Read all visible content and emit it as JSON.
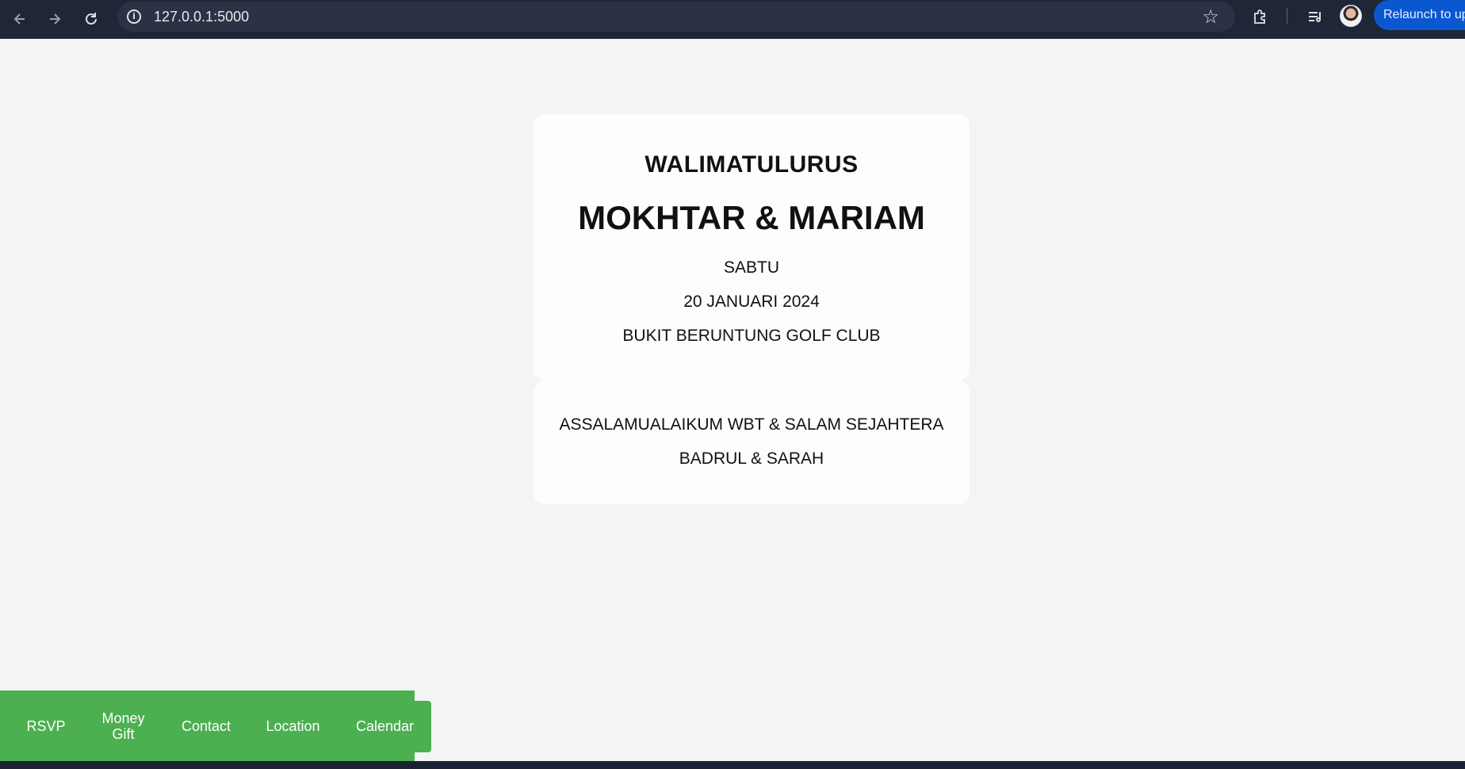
{
  "browser": {
    "url": "127.0.0.1:5000",
    "relaunch_label": "Relaunch to update",
    "accent": "#0b57d0"
  },
  "invitation": {
    "event": "WALIMATULURUS",
    "couple": "MOKHTAR & MARIAM",
    "day": "SABTU",
    "date": "20 JANUARI 2024",
    "venue": "BUKIT BERUNTUNG GOLF CLUB",
    "greeting": "ASSALAMUALAIKUM WBT & SALAM SEJAHTERA",
    "hosts": "BADRUL & SARAH"
  },
  "bottom_nav": {
    "color": "#4caf50",
    "items": [
      {
        "label": "RSVP"
      },
      {
        "label": "Money Gift"
      },
      {
        "label": "Contact"
      },
      {
        "label": "Location"
      },
      {
        "label": "Calendar"
      }
    ]
  }
}
